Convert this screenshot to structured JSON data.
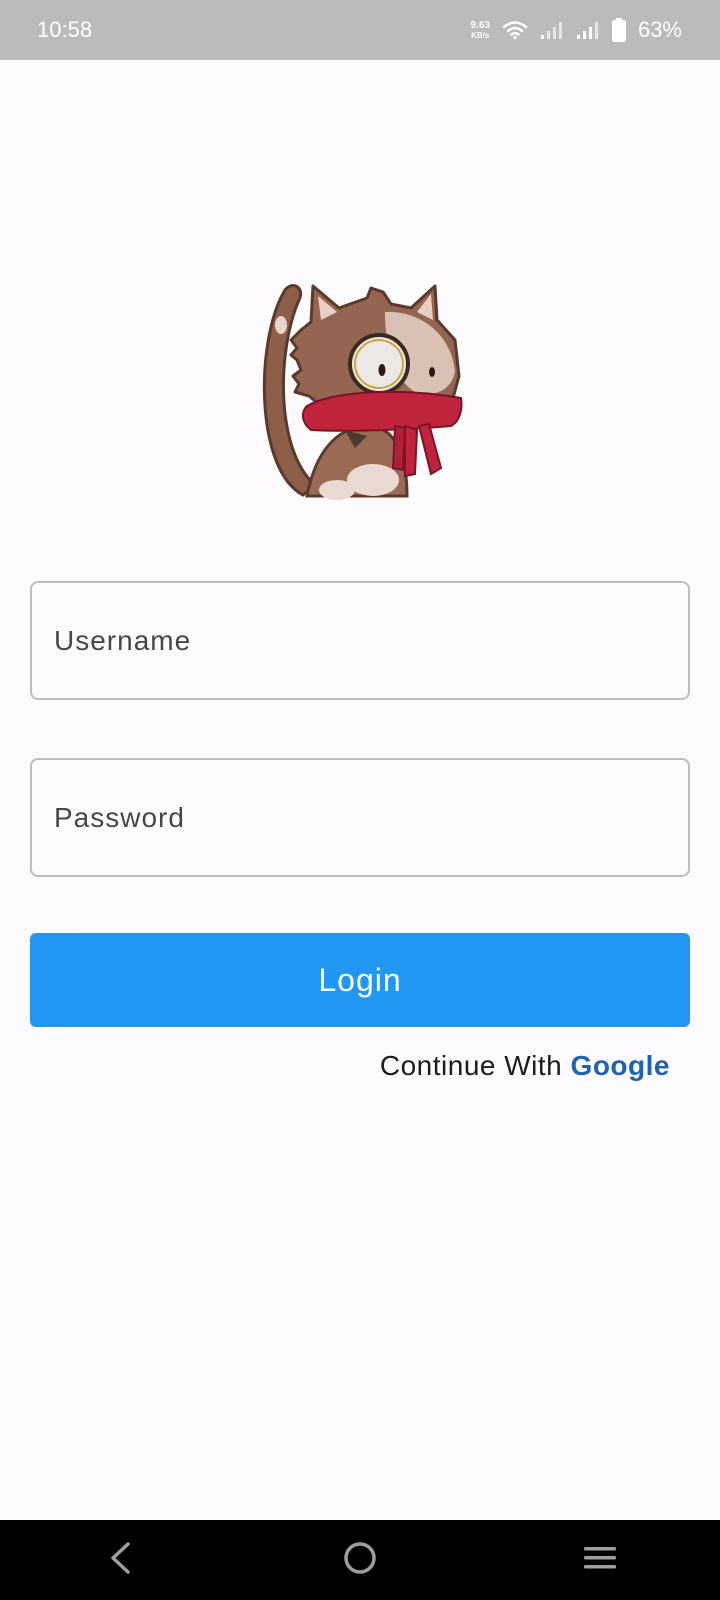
{
  "status_bar": {
    "time": "10:58",
    "net_speed_value": "9.63",
    "net_speed_unit": "KB/s",
    "battery": "63%"
  },
  "login_form": {
    "username_placeholder": "Username",
    "password_placeholder": "Password",
    "login_label": "Login",
    "continue_text": "Continue With",
    "google_label": "Google"
  },
  "icons": {
    "wifi": "wifi-icon",
    "signal_1": "signal-icon",
    "signal_2": "signal-icon",
    "battery": "battery-icon",
    "back": "back-icon",
    "home": "home-icon",
    "menu": "menu-icon",
    "mascot": "cat-mascot-with-monocle-and-scarf"
  },
  "colors": {
    "status_bar_bg": "#bcbbbc",
    "page_bg": "#fefbff",
    "primary_button": "#2196f3",
    "google_link": "#1e63b0",
    "nav_bar_bg": "#000000"
  }
}
